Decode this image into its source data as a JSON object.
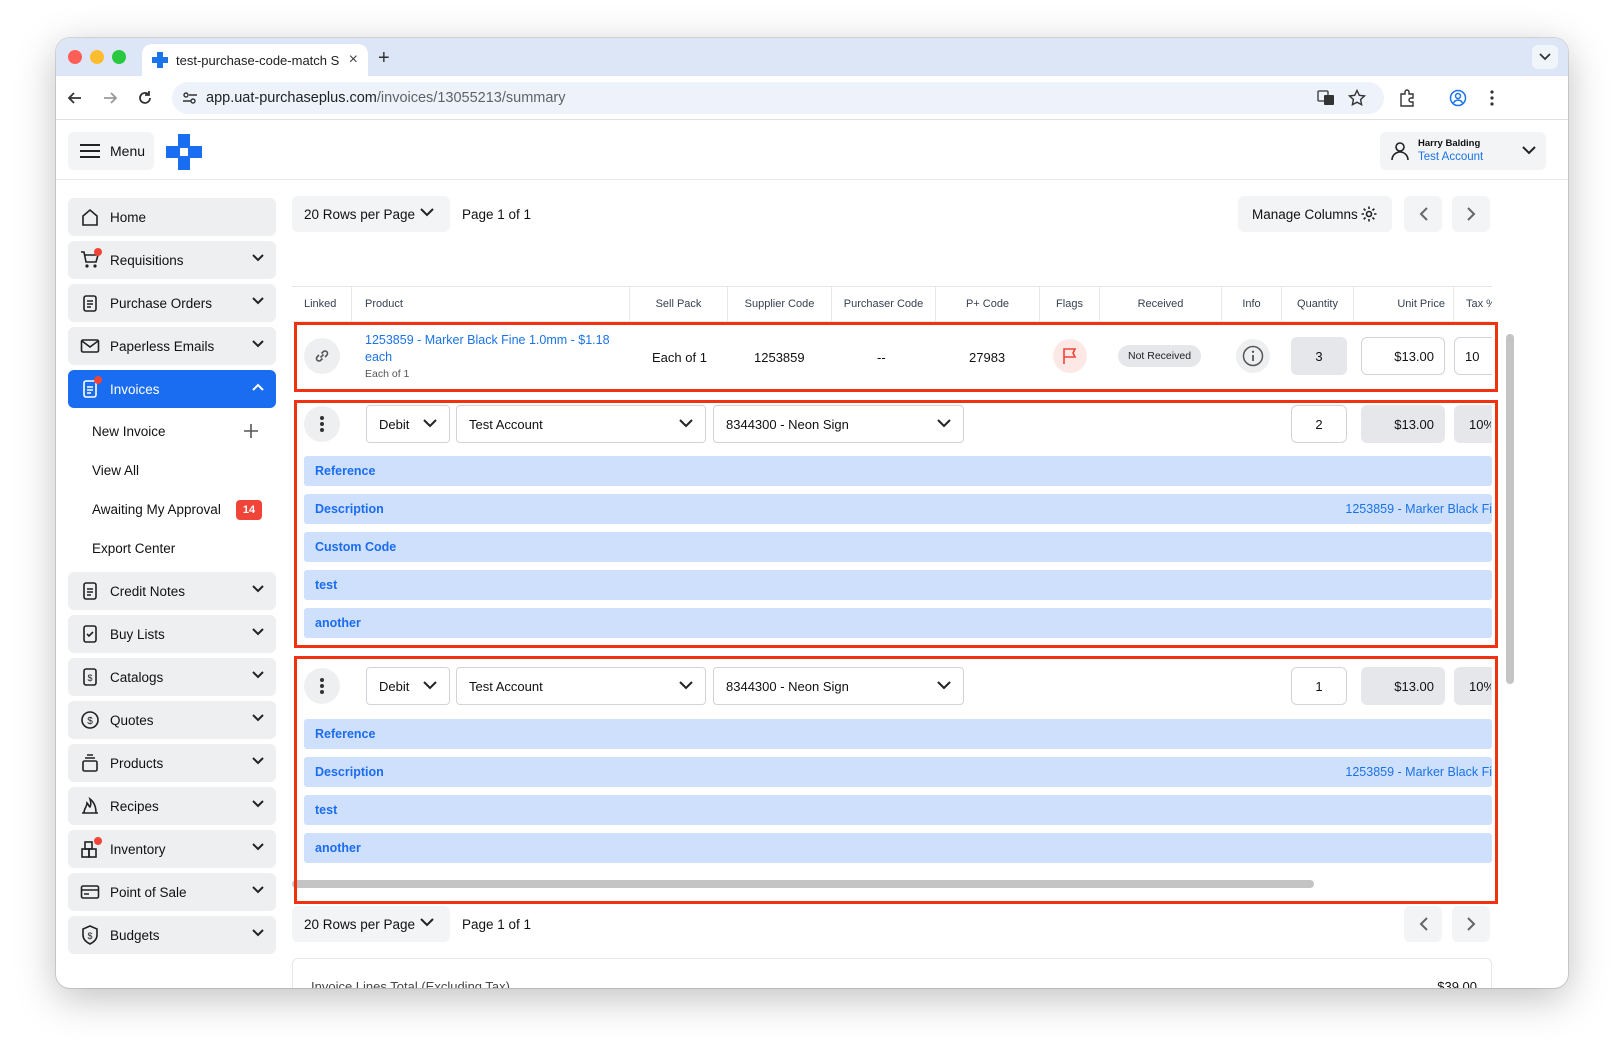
{
  "browser": {
    "tab_title": "test-purchase-code-match S",
    "url_host": "app.uat-purchaseplus.com",
    "url_path": "/invoices/13055213/summary"
  },
  "header": {
    "menu_label": "Menu",
    "user_name": "Harry Balding",
    "user_account": "Test Account"
  },
  "sidebar": {
    "items": [
      {
        "label": "Home"
      },
      {
        "label": "Requisitions"
      },
      {
        "label": "Purchase Orders"
      },
      {
        "label": "Paperless Emails"
      },
      {
        "label": "Invoices"
      },
      {
        "label": "Credit Notes"
      },
      {
        "label": "Buy Lists"
      },
      {
        "label": "Catalogs"
      },
      {
        "label": "Quotes"
      },
      {
        "label": "Products"
      },
      {
        "label": "Recipes"
      },
      {
        "label": "Inventory"
      },
      {
        "label": "Point of Sale"
      },
      {
        "label": "Budgets"
      }
    ],
    "invoice_sub": {
      "new_invoice": "New Invoice",
      "view_all": "View All",
      "awaiting": "Awaiting My Approval",
      "awaiting_count": "14",
      "export_center": "Export Center"
    }
  },
  "pagination": {
    "rows_per_page": "20 Rows per Page",
    "page_info": "Page 1 of 1",
    "manage_columns": "Manage Columns"
  },
  "table": {
    "columns": [
      "Linked",
      "Product",
      "Sell Pack",
      "Supplier Code",
      "Purchaser Code",
      "P+ Code",
      "Flags",
      "Received",
      "Info",
      "Quantity",
      "Unit Price",
      "Tax %"
    ],
    "row": {
      "product_name": "1253859 - Marker Black Fine 1.0mm - $1.18 each",
      "product_sub": "Each of 1",
      "sell_pack": "Each of 1",
      "supplier_code": "1253859",
      "purchaser_code": "--",
      "pplus_code": "27983",
      "received": "Not Received",
      "quantity": "3",
      "unit_price": "$13.00",
      "tax": "10"
    },
    "splits": [
      {
        "type": "Debit",
        "account": "Test Account",
        "code": "8344300 - Neon Sign",
        "quantity": "2",
        "unit_price": "$13.00",
        "tax": "10%",
        "bands": [
          {
            "label": "Reference",
            "value": ""
          },
          {
            "label": "Description",
            "value": "1253859 - Marker Black Fi"
          },
          {
            "label": "Custom Code",
            "value": ""
          },
          {
            "label": "test",
            "value": ""
          },
          {
            "label": "another",
            "value": ""
          }
        ]
      },
      {
        "type": "Debit",
        "account": "Test Account",
        "code": "8344300 - Neon Sign",
        "quantity": "1",
        "unit_price": "$13.00",
        "tax": "10%",
        "bands": [
          {
            "label": "Reference",
            "value": ""
          },
          {
            "label": "Description",
            "value": "1253859 - Marker Black Fi"
          },
          {
            "label": "test",
            "value": ""
          },
          {
            "label": "another",
            "value": ""
          }
        ]
      }
    ]
  },
  "totals": {
    "lines_total_label": "Invoice Lines Total (Excluding Tax)",
    "lines_total_value": "$39.00"
  },
  "colors": {
    "accent": "#1a6cf0",
    "highlight": "#f0330e",
    "band": "#cfe0fc",
    "badge": "#f04438"
  }
}
